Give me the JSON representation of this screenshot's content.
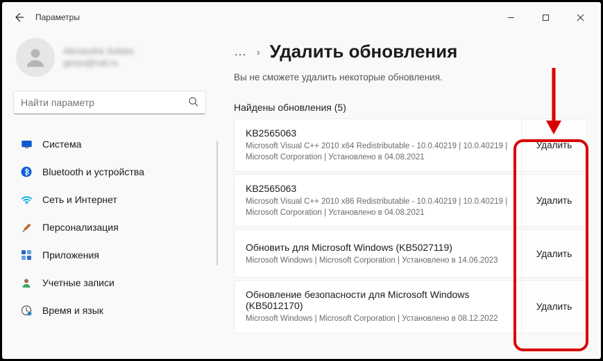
{
  "window": {
    "title": "Параметры"
  },
  "profile": {
    "name": "Alexandra Sobiex",
    "email": "geryu@ruti.ru"
  },
  "search": {
    "placeholder": "Найти параметр"
  },
  "sidebar": {
    "items": [
      {
        "label": "Система",
        "icon": "monitor-icon",
        "color": "#0a5bd6"
      },
      {
        "label": "Bluetooth и устройства",
        "icon": "bluetooth-icon",
        "color": "#0a5bd6"
      },
      {
        "label": "Сеть и Интернет",
        "icon": "wifi-icon",
        "color": "#00a8e0"
      },
      {
        "label": "Персонализация",
        "icon": "brush-icon",
        "color": "#c06a2a"
      },
      {
        "label": "Приложения",
        "icon": "apps-icon",
        "color": "#2a6ac0"
      },
      {
        "label": "Учетные записи",
        "icon": "person-icon",
        "color": "#a56a4a"
      },
      {
        "label": "Время и язык",
        "icon": "clock-globe-icon",
        "color": "#555"
      }
    ]
  },
  "breadcrumb": {
    "dots": "…",
    "sep": "›",
    "title": "Удалить обновления"
  },
  "subtitle": "Вы не сможете удалить некоторые обновления.",
  "section_label": "Найдены обновления (5)",
  "uninstall_label": "Удалить",
  "updates": [
    {
      "title": "KB2565063",
      "meta": "Microsoft Visual C++ 2010  x64 Redistributable - 10.0.40219   |   10.0.40219   |   Microsoft Corporation   |   Установлено в 04.08.2021"
    },
    {
      "title": "KB2565063",
      "meta": "Microsoft Visual C++ 2010  x86 Redistributable - 10.0.40219   |   10.0.40219   |   Microsoft Corporation   |   Установлено в 04.08.2021"
    },
    {
      "title": "Обновить для Microsoft Windows (KB5027119)",
      "meta": "Microsoft Windows   |   Microsoft Corporation   |   Установлено в 14.06.2023"
    },
    {
      "title": "Обновление безопасности для Microsoft Windows (KB5012170)",
      "meta": "Microsoft Windows   |   Microsoft Corporation   |   Установлено в 08.12.2022"
    }
  ]
}
